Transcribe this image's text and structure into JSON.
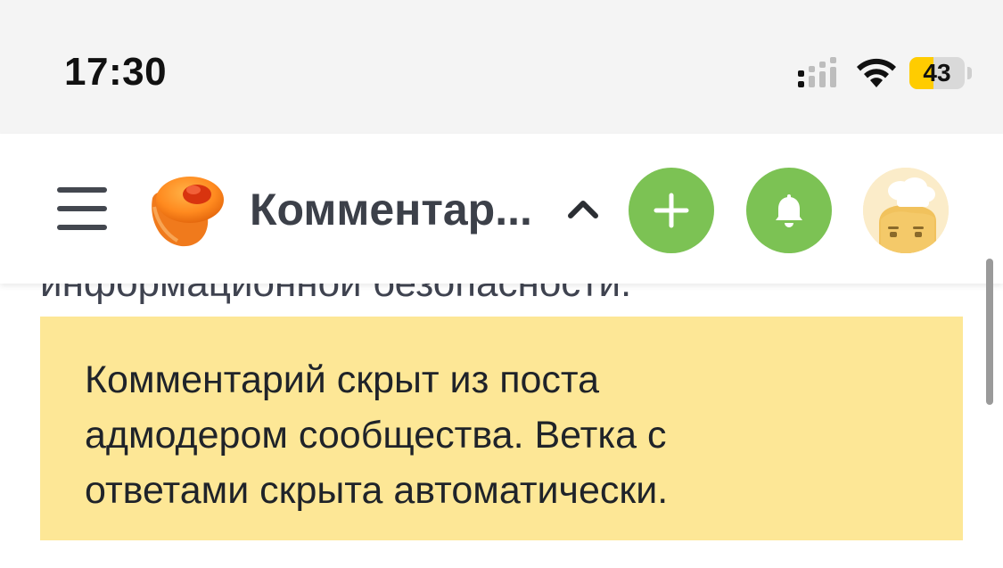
{
  "status_bar": {
    "time": "17:30",
    "battery_level": "43",
    "battery_color": "#ffcc00",
    "signal_icon": "cellular-signal-icon",
    "wifi_icon": "wifi-icon"
  },
  "header": {
    "menu_icon": "hamburger-menu-icon",
    "logo_icon": "pikabu-logo-icon",
    "title": "Комментар...",
    "collapse_icon": "chevron-up-icon",
    "add_icon": "plus-icon",
    "notifications_icon": "bell-icon",
    "avatar_icon": "user-avatar-chef-icon",
    "accent_color": "#7cc254"
  },
  "content": {
    "partial_text": "информационной безопасности.",
    "notice": {
      "line1": "Комментарий скрыт из поста",
      "line2": "адмодером сообщества. Ветка с",
      "line3": "ответами скрыта автоматически.",
      "background": "#fde796"
    }
  }
}
